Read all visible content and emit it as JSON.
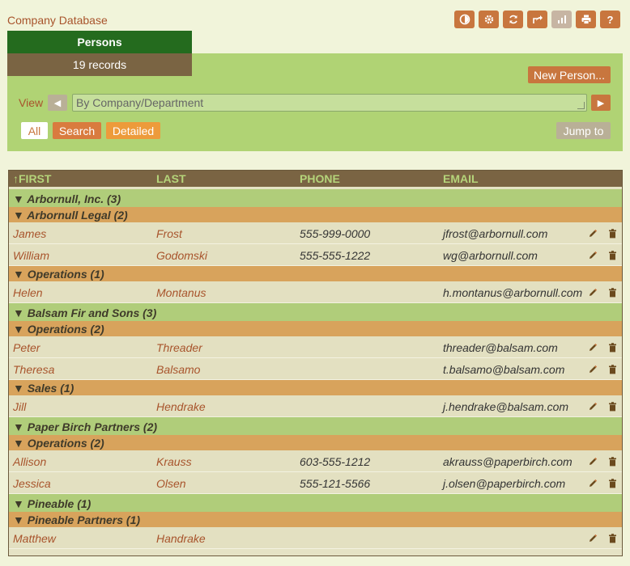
{
  "app": {
    "title": "Company Database"
  },
  "toolbar": {
    "buttons": [
      {
        "name": "theme-icon",
        "label": ""
      },
      {
        "name": "gear-icon",
        "label": ""
      },
      {
        "name": "refresh-icon",
        "label": ""
      },
      {
        "name": "share-icon",
        "label": ""
      },
      {
        "name": "chart-icon",
        "label": "",
        "disabled": true
      },
      {
        "name": "print-icon",
        "label": ""
      },
      {
        "name": "help-icon",
        "label": "?"
      }
    ]
  },
  "tabs": {
    "persons": "Persons",
    "records": "19 records"
  },
  "panel": {
    "new_person": "New Person...",
    "view_label": "View",
    "view_value": "By Company/Department",
    "filters": {
      "all": "All",
      "search": "Search",
      "detailed": "Detailed"
    },
    "jump_to": "Jump to"
  },
  "columns": {
    "first": "↑FIRST",
    "last": "LAST",
    "phone": "PHONE",
    "email": "EMAIL"
  },
  "groups": [
    {
      "label": "▼ Arbornull, Inc. (3)",
      "departments": [
        {
          "label": "▼ Arbornull Legal (2)",
          "rows": [
            {
              "first": "James",
              "last": "Frost",
              "phone": "555-999-0000",
              "email": "jfrost@arbornull.com"
            },
            {
              "first": "William",
              "last": "Godomski",
              "phone": "555-555-1222",
              "email": "wg@arbornull.com"
            }
          ]
        },
        {
          "label": "▼ Operations (1)",
          "rows": [
            {
              "first": "Helen",
              "last": "Montanus",
              "phone": "",
              "email": "h.montanus@arbornull.com"
            }
          ]
        }
      ]
    },
    {
      "label": "▼ Balsam Fir and Sons (3)",
      "departments": [
        {
          "label": "▼ Operations (2)",
          "rows": [
            {
              "first": "Peter",
              "last": "Threader",
              "phone": "",
              "email": "threader@balsam.com"
            },
            {
              "first": "Theresa",
              "last": "Balsamo",
              "phone": "",
              "email": "t.balsamo@balsam.com"
            }
          ]
        },
        {
          "label": "▼ Sales (1)",
          "rows": [
            {
              "first": "Jill",
              "last": "Hendrake",
              "phone": "",
              "email": "j.hendrake@balsam.com"
            }
          ]
        }
      ]
    },
    {
      "label": "▼ Paper Birch Partners (2)",
      "departments": [
        {
          "label": "▼ Operations (2)",
          "rows": [
            {
              "first": "Allison",
              "last": "Krauss",
              "phone": "603-555-1212",
              "email": "akrauss@paperbirch.com"
            },
            {
              "first": "Jessica",
              "last": "Olsen",
              "phone": "555-121-5566",
              "email": "j.olsen@paperbirch.com"
            }
          ]
        }
      ]
    },
    {
      "label": "▼ Pineable (1)",
      "departments": [
        {
          "label": "▼ Pineable Partners (1)",
          "rows": [
            {
              "first": "Matthew",
              "last": "Handrake",
              "phone": "",
              "email": ""
            }
          ]
        }
      ]
    }
  ],
  "colors": {
    "accent": "#c8763e",
    "tab_active": "#246b1e",
    "tab_records": "#7a6443",
    "panel": "#b0d374",
    "group_company": "#b0cd7a",
    "group_department": "#d8a35c"
  }
}
